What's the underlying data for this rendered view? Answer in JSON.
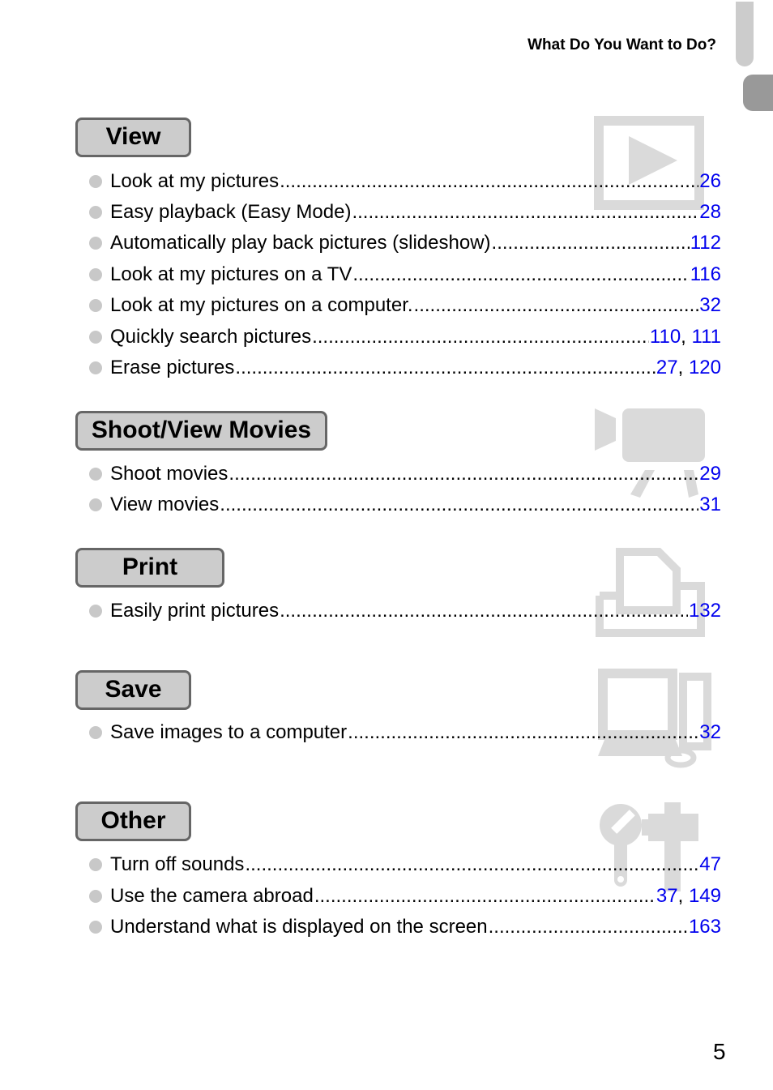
{
  "header": {
    "title": "What Do You Want to Do?"
  },
  "colors": {
    "link": "#0000ee",
    "label_bg": "#cccccc",
    "label_border": "#666666",
    "icon_gray": "#dadada",
    "bullet": "#c8c8c8"
  },
  "sections": [
    {
      "label": "View",
      "icon": "playback-icon",
      "items": [
        {
          "text": "Look at my pictures",
          "pages": [
            "26"
          ]
        },
        {
          "text": "Easy playback (Easy Mode)",
          "pages": [
            "28"
          ]
        },
        {
          "text": "Automatically play back pictures (slideshow)",
          "pages": [
            "112"
          ]
        },
        {
          "text": "Look at my pictures on a TV ",
          "pages": [
            "116"
          ]
        },
        {
          "text": "Look at my pictures on a computer. ",
          "pages": [
            "32"
          ]
        },
        {
          "text": "Quickly search pictures",
          "pages": [
            "110",
            "111"
          ]
        },
        {
          "text": "Erase pictures ",
          "pages": [
            "27",
            "120"
          ]
        }
      ]
    },
    {
      "label": "Shoot/View Movies",
      "icon": "movie-camera-icon",
      "items": [
        {
          "text": "Shoot movies ",
          "pages": [
            "29"
          ]
        },
        {
          "text": "View movies",
          "pages": [
            "31"
          ]
        }
      ]
    },
    {
      "label": "Print",
      "icon": "printer-icon",
      "items": [
        {
          "text": "Easily print pictures",
          "pages": [
            "132"
          ]
        }
      ]
    },
    {
      "label": "Save",
      "icon": "computer-icon",
      "items": [
        {
          "text": "Save images to a computer ",
          "pages": [
            "32"
          ]
        }
      ]
    },
    {
      "label": "Other",
      "icon": "tools-icon",
      "items": [
        {
          "text": "Turn off sounds ",
          "pages": [
            "47"
          ]
        },
        {
          "text": "Use the camera abroad",
          "pages": [
            "37",
            "149"
          ]
        },
        {
          "text": "Understand what is displayed on the screen ",
          "pages": [
            "163"
          ]
        }
      ]
    }
  ],
  "page_number": "5"
}
